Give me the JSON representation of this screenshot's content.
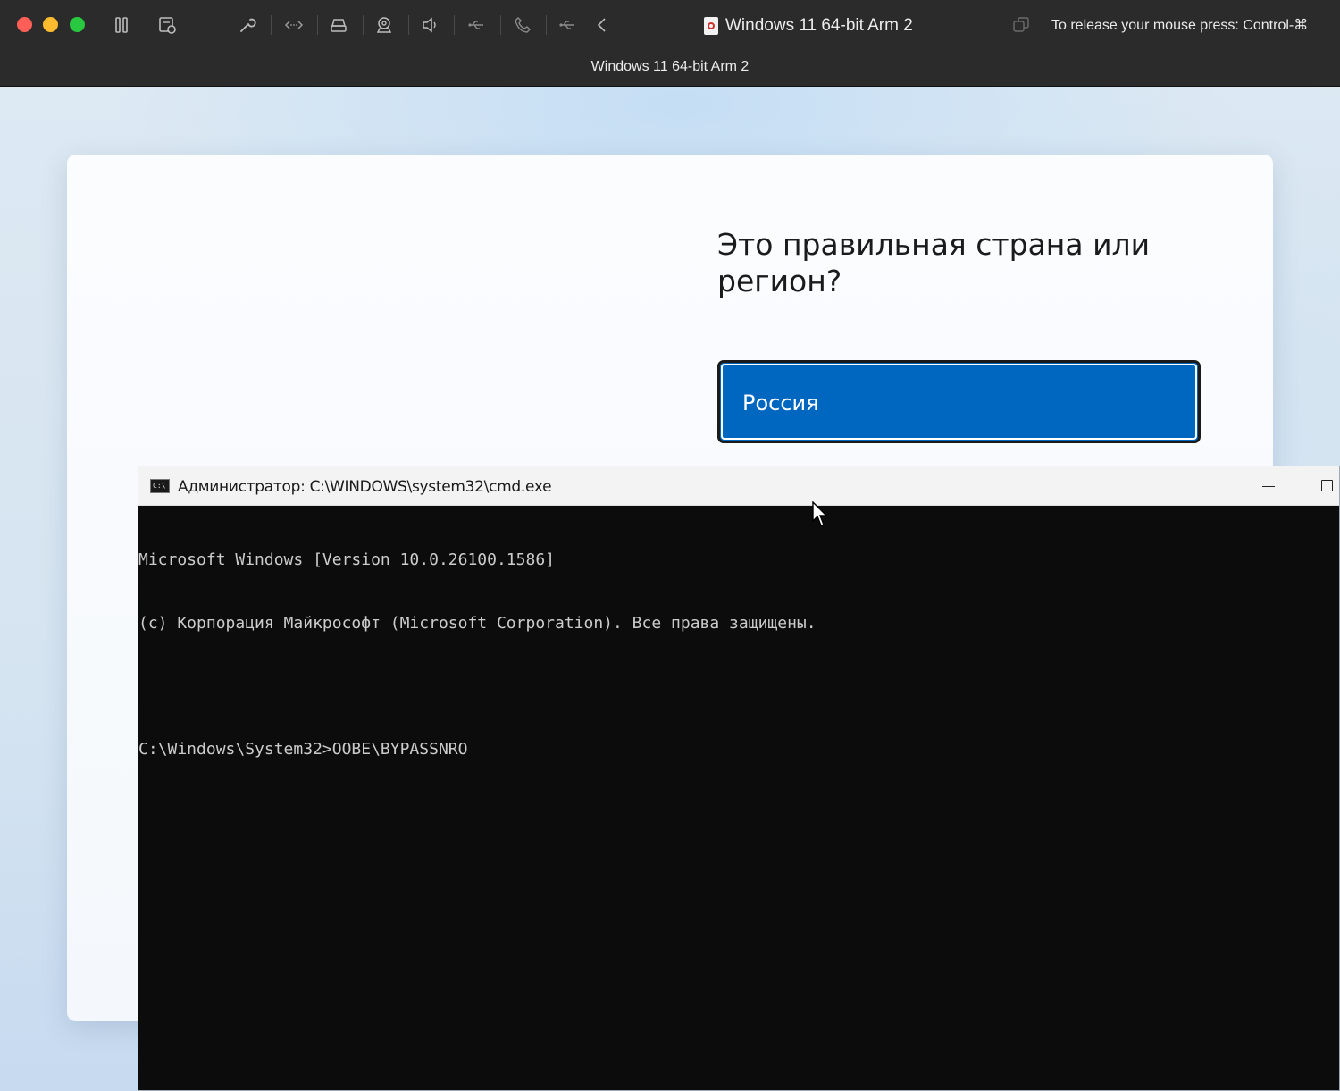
{
  "vm_window": {
    "title": "Windows 11 64-bit Arm 2",
    "subtitle": "Windows 11 64-bit Arm 2",
    "release_hint": "To release your mouse press: Control-⌘",
    "toolbar_icons": [
      "pause-icon",
      "snapshot-icon",
      "settings-wrench-icon",
      "network-icon",
      "hard-disk-icon",
      "camera-icon",
      "sound-icon",
      "usb-icon",
      "phone-icon",
      "usb-icon",
      "back-chevron-icon"
    ]
  },
  "oobe": {
    "heading": "Это правильная страна или регион?",
    "selected_country": "Россия",
    "accent_color": "#0067c0"
  },
  "cmd": {
    "title": "Администратор: C:\\WINDOWS\\system32\\cmd.exe",
    "icon_text": "C:\\",
    "lines": [
      "Microsoft Windows [Version 10.0.26100.1586]",
      "(c) Корпорация Майкрософт (Microsoft Corporation). Все права защищены.",
      "",
      "C:\\Windows\\System32>OOBE\\BYPASSNRO"
    ]
  }
}
